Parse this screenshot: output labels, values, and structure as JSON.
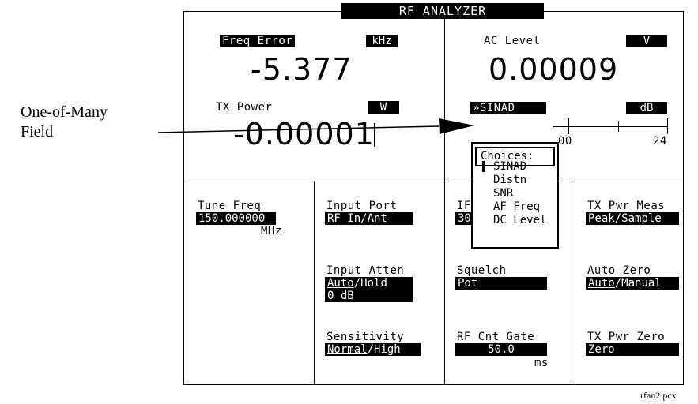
{
  "screen": {
    "title": "RF ANALYZER",
    "meters": {
      "freq_error": {
        "label": "Freq Error",
        "unit": "kHz",
        "value": "-5.377"
      },
      "ac_level": {
        "label": "AC Level",
        "unit": "V",
        "value": "0.00009"
      },
      "tx_power": {
        "label": "TX Power",
        "unit": "W",
        "value": "-0.00001"
      },
      "sinad": {
        "label": "»SINAD",
        "unit": "dB",
        "scale_left": "00",
        "scale_right": "24"
      }
    },
    "fields": {
      "tune_freq": {
        "label": "Tune Freq",
        "value": "150.000000",
        "unit": "MHz"
      },
      "input_port": {
        "label": "Input Port",
        "selected": "RF In",
        "sep": "/",
        "other": "Ant"
      },
      "input_atten": {
        "label": "Input Atten",
        "selected": "Auto",
        "sep": "/",
        "other": "Hold",
        "value": "0 dB"
      },
      "sensitivity": {
        "label": "Sensitivity",
        "selected": "Normal",
        "sep": "/",
        "other": "High"
      },
      "if_filter": {
        "label": "IF",
        "value": "30"
      },
      "squelch": {
        "label": "Squelch",
        "value": "Pot"
      },
      "rf_cnt_gate": {
        "label": "RF Cnt Gate",
        "value": "50.0",
        "unit": "ms"
      },
      "tx_pwr_meas": {
        "label": "TX Pwr Meas",
        "selected": "Peak",
        "sep": "/",
        "other": "Sample"
      },
      "auto_zero": {
        "label": "Auto Zero",
        "selected": "Auto",
        "sep": "/",
        "other": "Manual"
      },
      "tx_pwr_zero": {
        "label": "TX Pwr Zero",
        "value": "Zero"
      }
    },
    "choices_popup": {
      "header": "Choices:",
      "items": [
        "SINAD",
        "Distn",
        "SNR",
        "AF Freq",
        "DC Level"
      ],
      "selected_index": 0
    }
  },
  "annotation": {
    "line1": "One-of-Many",
    "line2": "Field"
  },
  "filename": "rfan2.pcx"
}
